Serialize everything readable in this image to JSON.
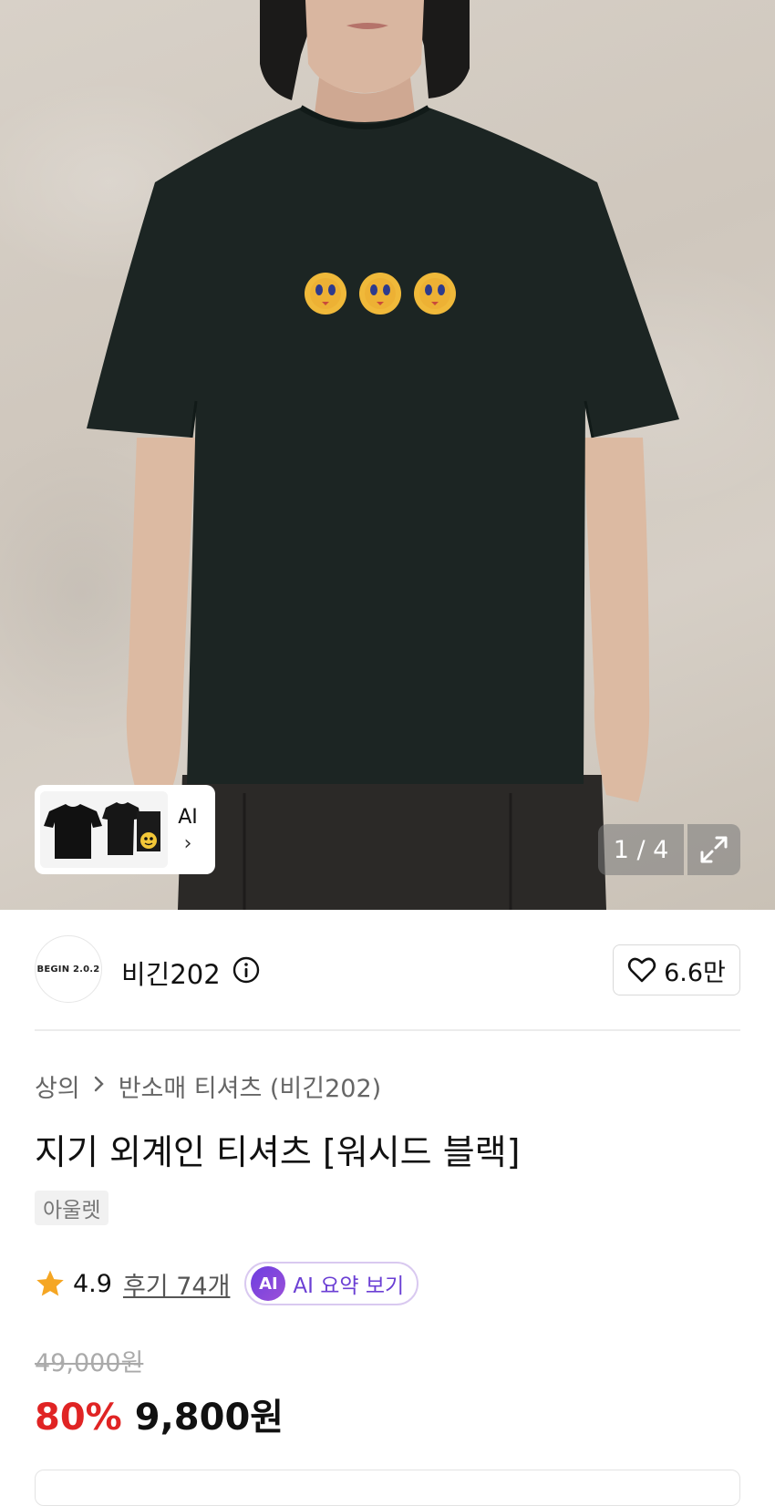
{
  "gallery": {
    "counter": "1 / 4",
    "ai_thumb_label": "AI",
    "ai_thumb_chevron": "›"
  },
  "brand": {
    "logo_text": "BEGIN 2.0.2",
    "name": "비긴202",
    "likes": "6.6만"
  },
  "breadcrumb": {
    "category": "상의",
    "subcategory": "반소매 티셔츠 (비긴202)"
  },
  "product": {
    "title": "지기 외계인 티셔츠 [워시드 블랙]",
    "tag": "아울렛",
    "rating": "4.9",
    "reviews": "후기 74개",
    "ai_badge": "AI",
    "ai_summary": "AI 요약 보기",
    "original_price": "49,000원",
    "discount": "80%",
    "sale_price": "9,800원"
  },
  "colors": {
    "discount": "#e02424",
    "star": "#f5a623",
    "ai_purple": "#6b3fd4"
  },
  "icons": [
    "heart-icon",
    "info-icon",
    "star-icon",
    "expand-icon",
    "chevron-right-icon"
  ]
}
